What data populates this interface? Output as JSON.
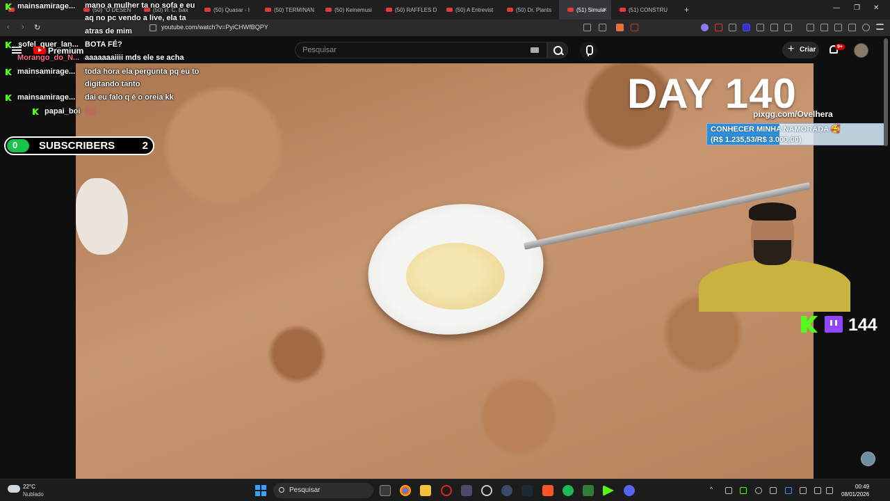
{
  "browser": {
    "tabs": [
      {
        "label": "(50) \"O DESEN"
      },
      {
        "label": "(50) И. С. Бах"
      },
      {
        "label": "(50) Quasar - I"
      },
      {
        "label": "(50) TERMINAN"
      },
      {
        "label": "(50) Keinemusi"
      },
      {
        "label": "(50) RAFFLES D"
      },
      {
        "label": "(50) A Entrevist"
      },
      {
        "label": "(50) Dr. Plants"
      }
    ],
    "active_tab": "(51) Simula",
    "last_tab": "(51) CONSTRU",
    "new_tab": "+",
    "url": "youtube.com/watch?v=PyiCHWfBQPY"
  },
  "youtube": {
    "premium_label": "Premium",
    "search_placeholder": "Pesquisar",
    "create_label": "Criar",
    "notification_count": "9+"
  },
  "video": {
    "day_label": "DAY 140",
    "pixgg": "pixgg.com/Ovelhera",
    "goal": {
      "title": "CONHECER MINHA NAMORADA 🥰",
      "amount": "(R$ 1.235,53/R$ 3.000,00)",
      "progress": 0.41
    },
    "viewer_count": "144",
    "subscribers": {
      "left": "0",
      "label": "SUBSCRIBERS",
      "right": "2"
    }
  },
  "chat": [
    {
      "user": "mainsamirage...",
      "color": "#53fc18",
      "message": "mano a mulher ta no sofa e eu"
    },
    {
      "user": "",
      "color": "#53fc18",
      "message": "aq no pc vendo a live, ela ta"
    },
    {
      "user": "",
      "color": "#53fc18",
      "message": "atras de mim"
    },
    {
      "user": "_sofel_quer_lan...",
      "color": "#53fc18",
      "message": "BOTA FÉ?"
    },
    {
      "user": "Morango_do_N...",
      "color": "#ff6b8b",
      "message": "aaaaaaaiiii mds ele se acha"
    },
    {
      "user": "mainsamirage...",
      "color": "#53fc18",
      "message": "toda hora ela pergunta pq eu to"
    },
    {
      "user": "",
      "color": "#53fc18",
      "message": "digitando tanto"
    },
    {
      "user": "mainsamirage...",
      "color": "#53fc18",
      "message": "dai eu falo q é o oreia kk"
    },
    {
      "user": "papai_boi",
      "color": "#53fc18",
      "message": ""
    }
  ],
  "taskbar": {
    "weather_temp": "22°C",
    "weather_cond": "Nublado",
    "search_label": "Pesquisar",
    "time": "00:49",
    "date": "08/01/2026"
  }
}
